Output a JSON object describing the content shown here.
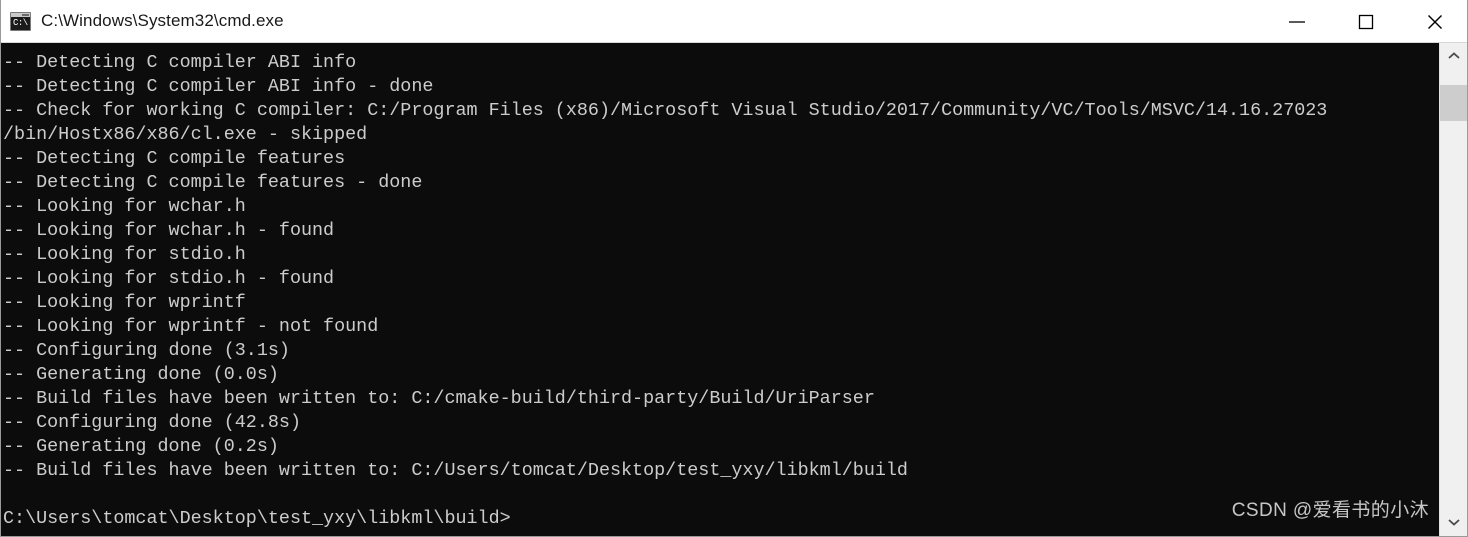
{
  "window": {
    "title": "C:\\Windows\\System32\\cmd.exe",
    "icon_name": "cmd-icon",
    "icon_text": "C:\\.",
    "minimize_label": "Minimize",
    "maximize_label": "Maximize",
    "close_label": "Close",
    "background_color": "#0c0c0c",
    "titlebar_color": "#ffffff",
    "text_color": "#cccccc"
  },
  "console": {
    "lines": [
      "-- Detecting C compiler ABI info",
      "-- Detecting C compiler ABI info - done",
      "-- Check for working C compiler: C:/Program Files (x86)/Microsoft Visual Studio/2017/Community/VC/Tools/MSVC/14.16.27023",
      "/bin/Hostx86/x86/cl.exe - skipped",
      "-- Detecting C compile features",
      "-- Detecting C compile features - done",
      "-- Looking for wchar.h",
      "-- Looking for wchar.h - found",
      "-- Looking for stdio.h",
      "-- Looking for stdio.h - found",
      "-- Looking for wprintf",
      "-- Looking for wprintf - not found",
      "-- Configuring done (3.1s)",
      "-- Generating done (0.0s)",
      "-- Build files have been written to: C:/cmake-build/third-party/Build/UriParser",
      "-- Configuring done (42.8s)",
      "-- Generating done (0.2s)",
      "-- Build files have been written to: C:/Users/tomcat/Desktop/test_yxy/libkml/build"
    ],
    "prompt": "C:\\Users\\tomcat\\Desktop\\test_yxy\\libkml\\build>"
  },
  "watermark": {
    "text": "CSDN @爱看书的小沐"
  },
  "scrollbar": {
    "up_arrow": "scroll-up",
    "down_arrow": "scroll-down",
    "thumb_label": "scroll-thumb"
  }
}
